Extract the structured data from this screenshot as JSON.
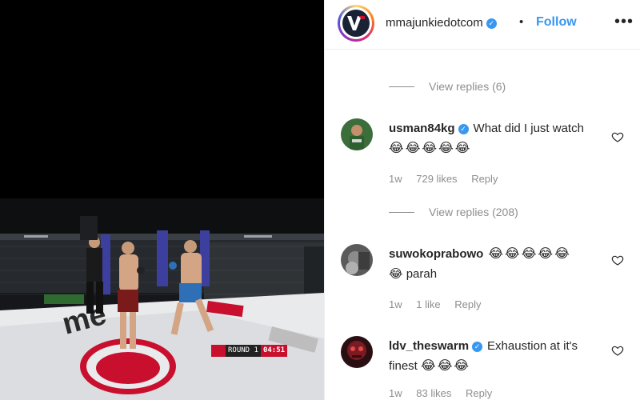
{
  "post": {
    "username": "mmajunkiedotcom",
    "separator": "•",
    "follow_label": "Follow",
    "more_label": "•••"
  },
  "video": {
    "scorebug": {
      "round": "ROUND 1",
      "time": "04:51"
    },
    "brand_text": "me"
  },
  "comments": [
    {
      "pre_replies": "View replies (6)"
    },
    {
      "username": "usman84kg",
      "text": "What did I just watch",
      "emojis": "😂😂😂😂😂",
      "age": "1w",
      "likes": "729 likes",
      "reply": "Reply",
      "replies": "View replies (208)"
    },
    {
      "username": "suwokoprabowo",
      "emojis": "😂😂😂😂😂",
      "text": "😂 parah",
      "age": "1w",
      "likes": "1 like",
      "reply": "Reply"
    },
    {
      "username": "ldv_theswarm",
      "text": "Exhaustion at it's finest",
      "emojis": "😂😂😂",
      "age": "1w",
      "likes": "83 likes",
      "reply": "Reply"
    }
  ],
  "colors": {
    "accent": "#3897f0",
    "muted": "#8e8e8e",
    "text": "#262626"
  }
}
